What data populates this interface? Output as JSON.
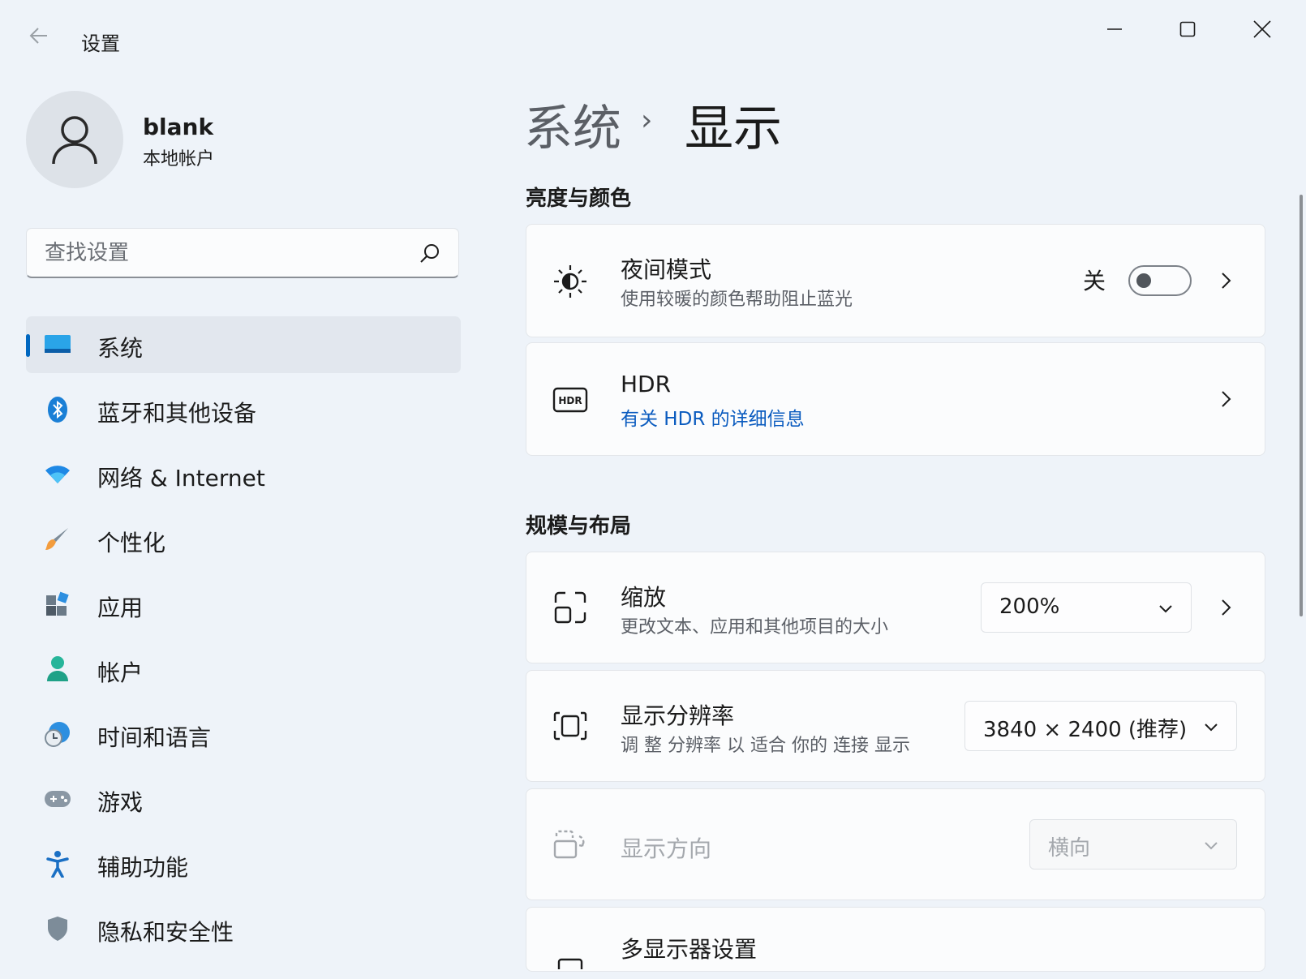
{
  "window": {
    "title": "设置",
    "controls": [
      "minimize",
      "maximize",
      "close"
    ]
  },
  "profile": {
    "name": "blank",
    "account_type": "本地帐户"
  },
  "search": {
    "placeholder": "查找设置"
  },
  "sidebar": {
    "items": [
      {
        "label": "系统",
        "icon": "monitor-icon",
        "active": true
      },
      {
        "label": "蓝牙和其他设备",
        "icon": "bluetooth-icon"
      },
      {
        "label": "网络 & Internet",
        "icon": "wifi-icon"
      },
      {
        "label": "个性化",
        "icon": "brush-icon"
      },
      {
        "label": "应用",
        "icon": "apps-icon"
      },
      {
        "label": "帐户",
        "icon": "person-icon"
      },
      {
        "label": "时间和语言",
        "icon": "globe-clock-icon"
      },
      {
        "label": "游戏",
        "icon": "gamepad-icon"
      },
      {
        "label": "辅助功能",
        "icon": "accessibility-icon"
      },
      {
        "label": "隐私和安全性",
        "icon": "shield-icon"
      }
    ]
  },
  "breadcrumb": {
    "parent": "系统",
    "separator": "›",
    "current": "显示"
  },
  "sections": {
    "brightness": {
      "title": "亮度与颜色",
      "night_light": {
        "title": "夜间模式",
        "subtitle": "使用较暖的颜色帮助阻止蓝光",
        "state_label": "关",
        "on": false
      },
      "hdr": {
        "title": "HDR",
        "link": "有关 HDR 的详细信息"
      }
    },
    "layout": {
      "title": "规模与布局",
      "scale": {
        "title": "缩放",
        "subtitle": "更改文本、应用和其他项目的大小",
        "value": "200%"
      },
      "resolution": {
        "title": "显示分辨率",
        "subtitle": "调 整 分辨率 以 适合 你的 连接 显示",
        "value": "3840 × 2400 (推荐)"
      },
      "orientation": {
        "title": "显示方向",
        "value": "横向",
        "disabled": true
      },
      "multi_display": {
        "title": "多显示器设置"
      }
    }
  },
  "colors": {
    "accent": "#0067c0",
    "link": "#0a5bbf",
    "background": "#eef3f9"
  }
}
